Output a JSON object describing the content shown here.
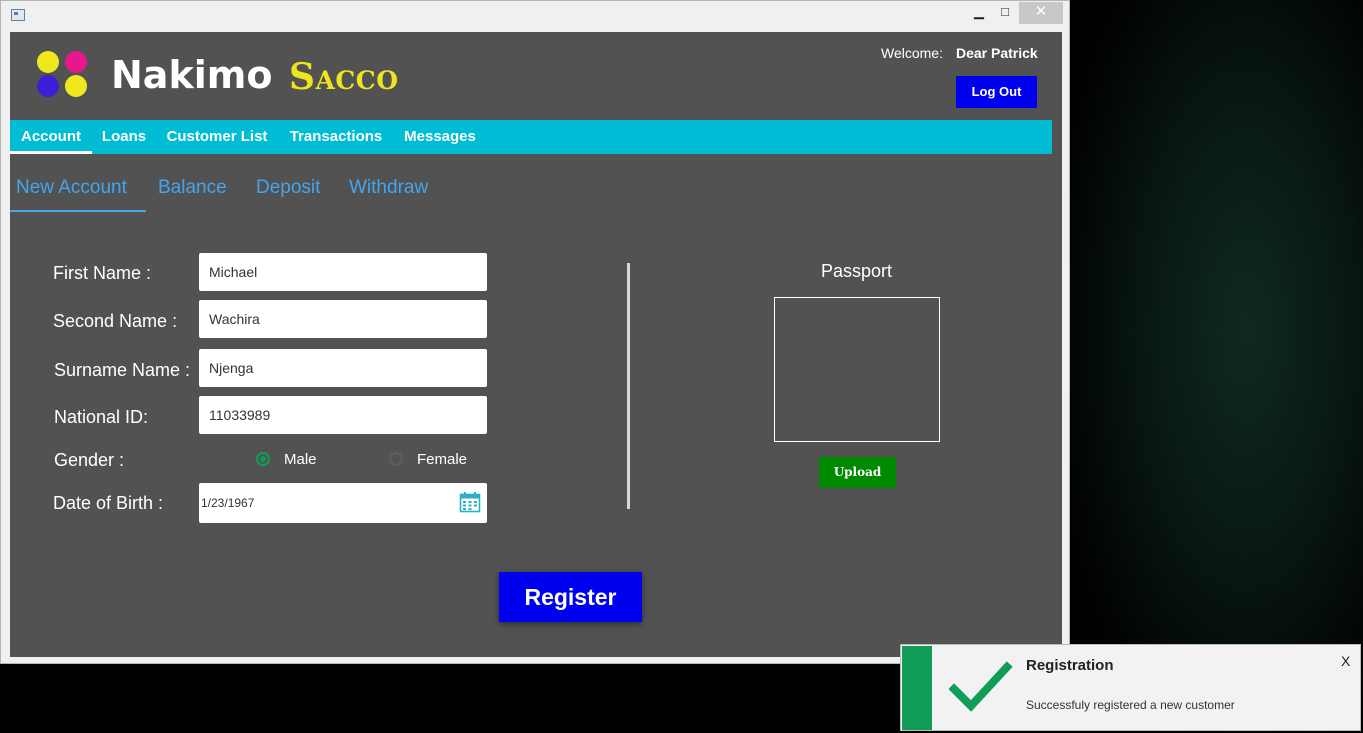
{
  "window": {
    "min_glyph": "▁",
    "max_glyph": "□",
    "close_glyph": "✕"
  },
  "brand": {
    "word1": "Nakimo",
    "word2": "Sacco"
  },
  "user": {
    "welcome_label": "Welcome:",
    "name": "Dear Patrick",
    "logout_label": "Log Out"
  },
  "main_nav": {
    "items": [
      {
        "label": "Account",
        "active": true
      },
      {
        "label": "Loans"
      },
      {
        "label": "Customer List"
      },
      {
        "label": "Transactions"
      },
      {
        "label": "Messages"
      }
    ]
  },
  "sub_tabs": {
    "items": [
      {
        "label": "New Account",
        "active": true
      },
      {
        "label": "Balance"
      },
      {
        "label": "Deposit"
      },
      {
        "label": "Withdraw"
      }
    ]
  },
  "form": {
    "first_name_label": "First Name :",
    "first_name_value": "Michael",
    "second_name_label": "Second Name :",
    "second_name_value": "Wachira",
    "surname_label": "Surname Name :",
    "surname_value": "Njenga",
    "national_id_label": "National ID:",
    "national_id_value": "11033989",
    "gender_label": "Gender :",
    "gender_male": "Male",
    "gender_female": "Female",
    "gender_selected": "Male",
    "dob_label": "Date of Birth :",
    "dob_value": "1/23/1967"
  },
  "passport": {
    "title": "Passport",
    "upload_label": "Upload"
  },
  "register_label": "Register",
  "toast": {
    "title": "Registration",
    "message": "Successfuly registered a new customer",
    "close": "X",
    "accent": "#0f9d58"
  },
  "colors": {
    "nav_bar": "#00bcd4",
    "primary_button": "#0000f0",
    "upload_button": "#008a00",
    "tab_text": "#44a4ec",
    "content_bg": "#525252"
  }
}
